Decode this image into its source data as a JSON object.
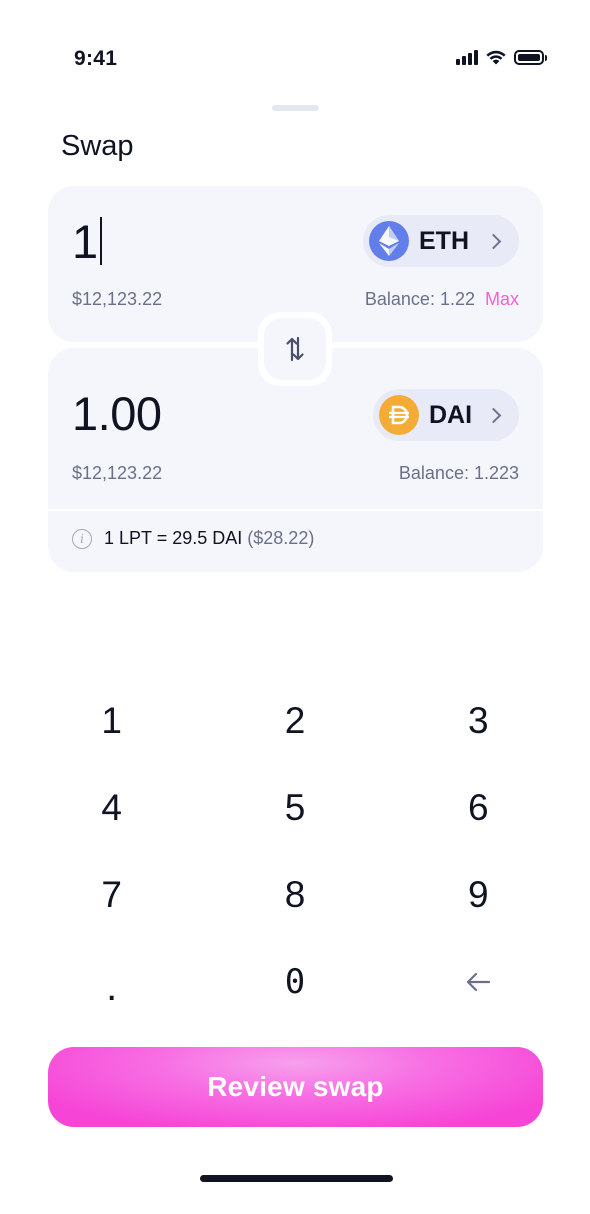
{
  "status_bar": {
    "time": "9:41"
  },
  "title": "Swap",
  "from": {
    "amount": "1",
    "token": "ETH",
    "token_icon": "ethereum-icon",
    "fiat_value": "$12,123.22",
    "balance": "Balance: 1.22",
    "max_label": "Max"
  },
  "to": {
    "amount": "1.00",
    "token": "DAI",
    "token_icon": "dai-icon",
    "fiat_value": "$12,123.22",
    "balance": "Balance: 1.223"
  },
  "rate": {
    "text": "1 LPT = 29.5 DAI",
    "fiat": "($28.22)"
  },
  "keypad": {
    "keys": [
      "1",
      "2",
      "3",
      "4",
      "5",
      "6",
      "7",
      "8",
      "9",
      ".",
      "0",
      "←"
    ]
  },
  "review_button": "Review swap",
  "colors": {
    "accent": "#f75dda",
    "card_bg": "#f5f6fc",
    "eth": "#627eea",
    "dai": "#f5ac37"
  }
}
